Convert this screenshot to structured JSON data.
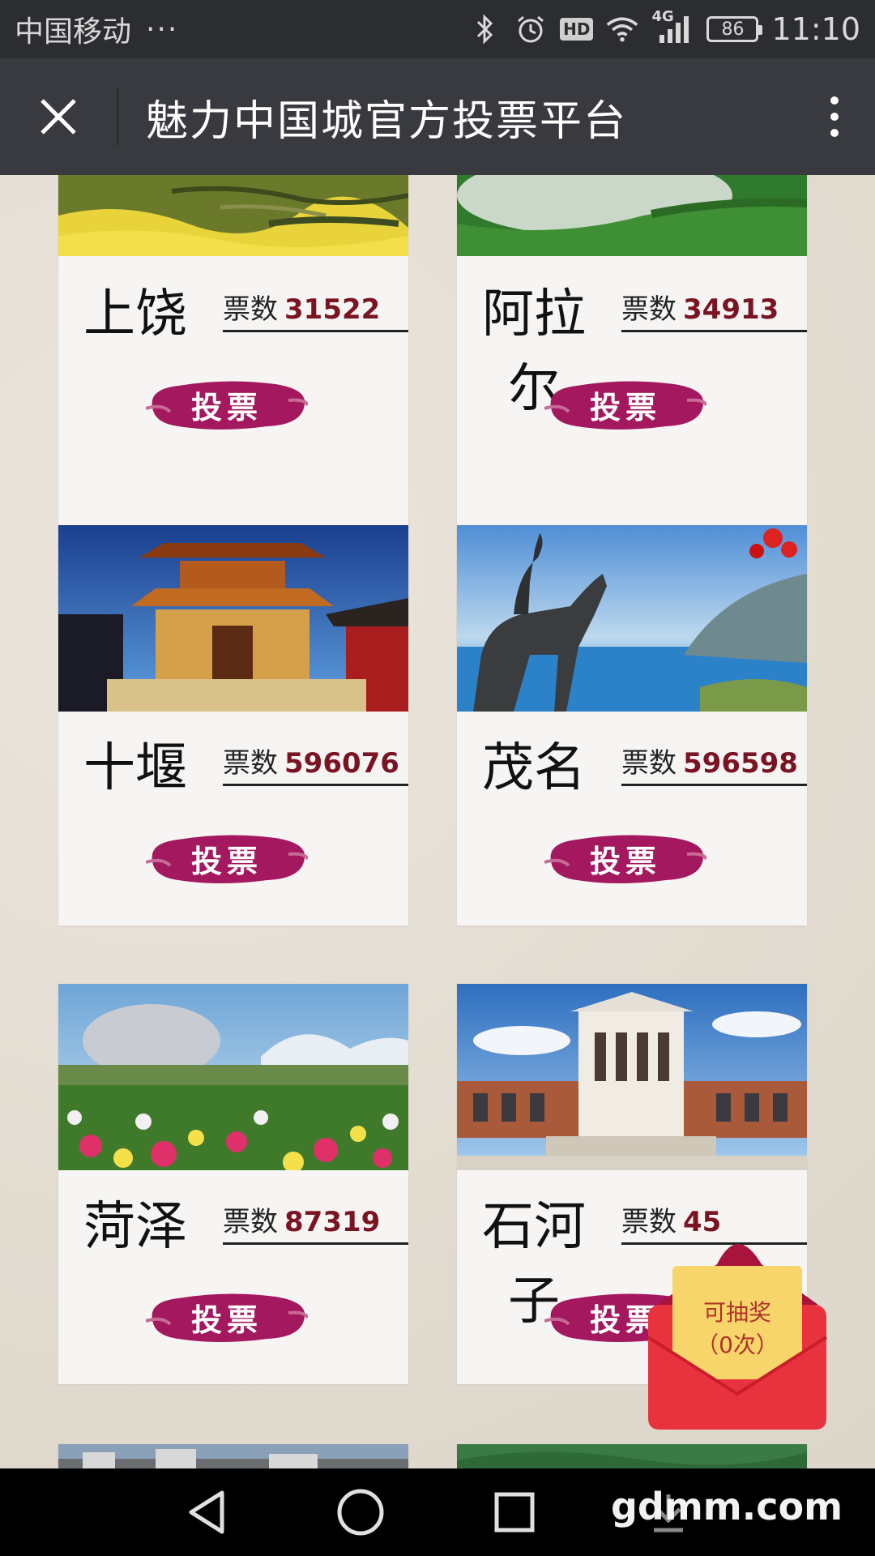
{
  "status_bar": {
    "carrier": "中国移动",
    "dots": "···",
    "hd": "HD",
    "network": "4G",
    "battery": "86",
    "time": "11:10",
    "icons": [
      "bluetooth-icon",
      "alarm-icon",
      "hd-icon",
      "wifi-icon",
      "signal-icon",
      "battery-icon"
    ]
  },
  "title_bar": {
    "title": "魅力中国城官方投票平台",
    "close_icon": "close-icon",
    "more_icon": "more-vertical-icon"
  },
  "vote_label": "票数",
  "button_label": "投票",
  "cards": [
    {
      "name": "上饶",
      "votes": "31522"
    },
    {
      "name": "阿拉尔",
      "votes": "34913"
    },
    {
      "name": "十堰",
      "votes": "596076"
    },
    {
      "name": "茂名",
      "votes": "596598"
    },
    {
      "name": "菏泽",
      "votes": "87319"
    },
    {
      "name": "石河子",
      "votes": "45"
    }
  ],
  "envelope": {
    "line1": "可抽奖",
    "line2": "（0次）"
  },
  "nav": {
    "icons": [
      "back-icon",
      "home-icon",
      "recents-icon",
      "download-icon"
    ]
  },
  "watermark": "gdmm.com",
  "colors": {
    "vote_number": "#7a1322",
    "button_brush": "#a3185f",
    "title_bar": "#393a3f",
    "status_bar": "#2b2d30"
  }
}
